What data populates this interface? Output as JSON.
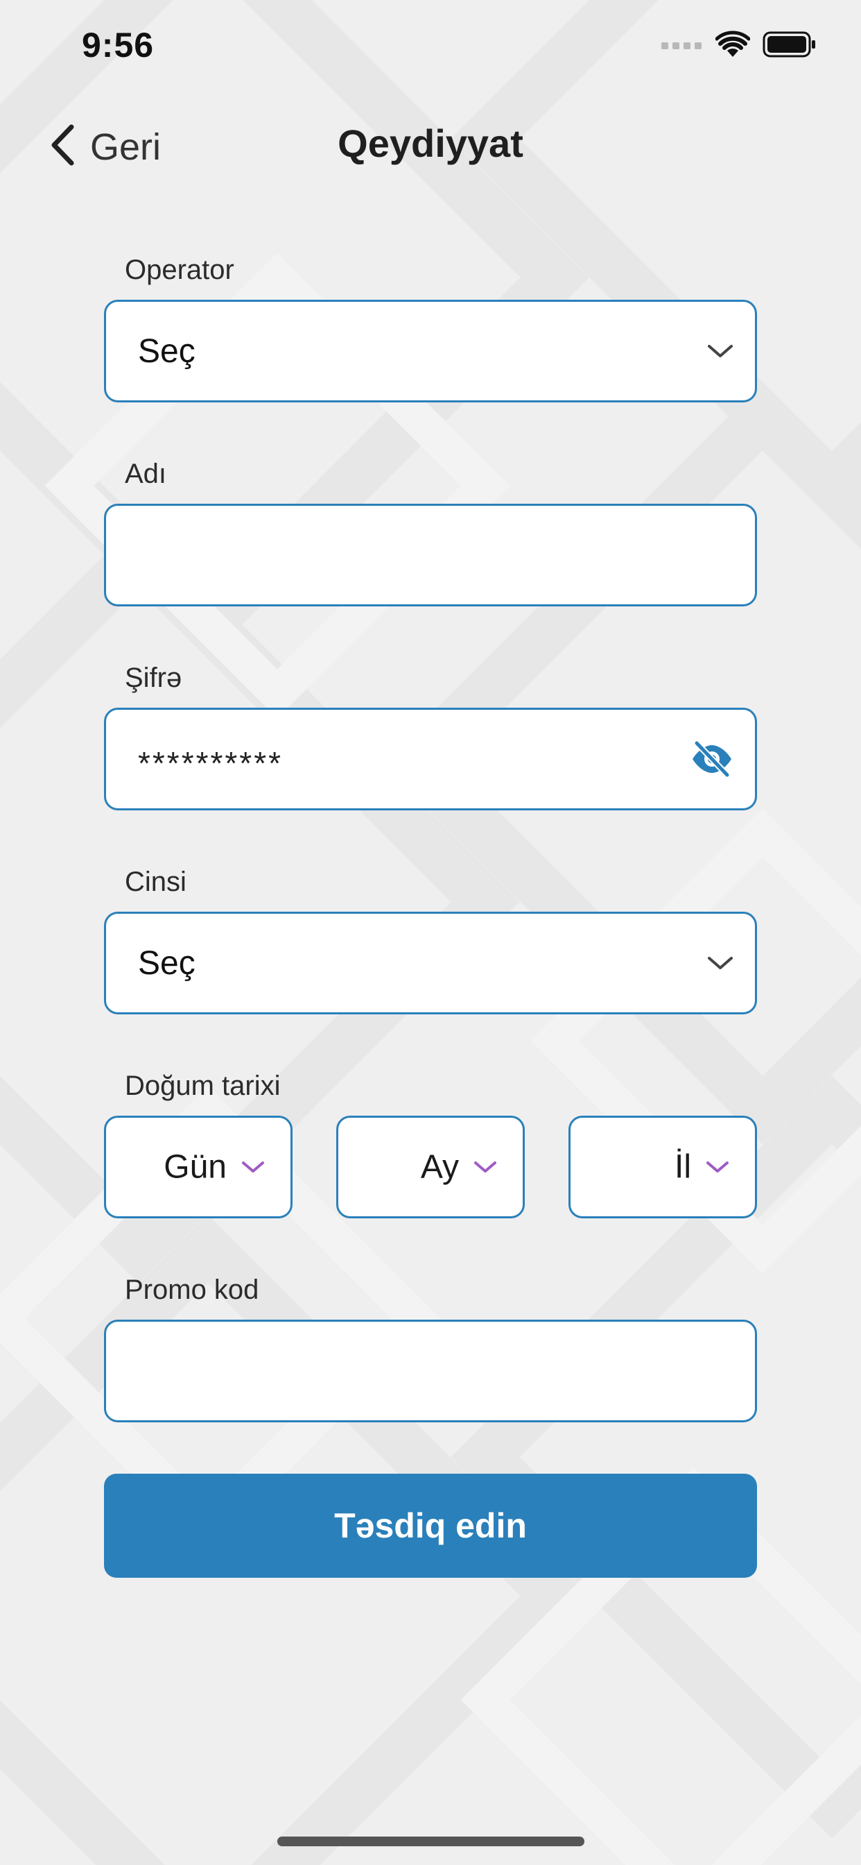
{
  "status_bar": {
    "time": "9:56"
  },
  "nav": {
    "back_label": "Geri",
    "title": "Qeydiyyat"
  },
  "form": {
    "operator": {
      "label": "Operator",
      "value": "Seç"
    },
    "name": {
      "label": "Adı",
      "value": ""
    },
    "password": {
      "label": "Şifrə",
      "value": "**********"
    },
    "gender": {
      "label": "Cinsi",
      "value": "Seç"
    },
    "birth_date": {
      "label": "Doğum tarixi",
      "day": "Gün",
      "month": "Ay",
      "year": "İl"
    },
    "promo": {
      "label": "Promo kod",
      "value": ""
    },
    "submit_label": "Təsdiq edin"
  },
  "icons": {
    "back": "chevron-left-icon",
    "dropdown": "chevron-down-icon",
    "password_toggle": "eye-off-icon",
    "signal": "cellular-signal-icon",
    "wifi": "wifi-icon",
    "battery": "battery-icon"
  },
  "colors": {
    "accent": "#2a80ba",
    "date_chevron": "#a05bc3",
    "background": "#efefef"
  }
}
